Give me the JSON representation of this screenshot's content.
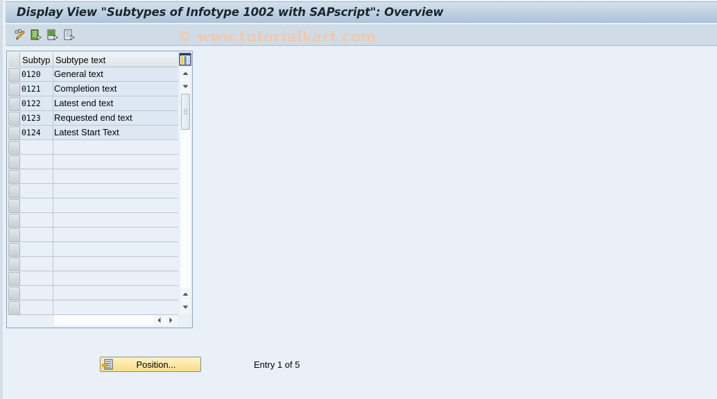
{
  "window": {
    "title": "Display View \"Subtypes of Infotype 1002 with SAPscript\": Overview"
  },
  "toolbar": {
    "buttons": [
      {
        "name": "display-change-button",
        "icon": "pencil-glasses-icon"
      },
      {
        "name": "select-all-button",
        "icon": "select-all-icon"
      },
      {
        "name": "select-block-button",
        "icon": "select-block-icon"
      },
      {
        "name": "deselect-all-button",
        "icon": "deselect-all-icon"
      }
    ],
    "watermark": "© www.tutorialkart.com"
  },
  "table": {
    "columns": [
      {
        "key": "subtype",
        "label": "Subtyp"
      },
      {
        "key": "text",
        "label": "Subtype text"
      }
    ],
    "rows": [
      {
        "subtype": "0120",
        "text": "General text"
      },
      {
        "subtype": "0121",
        "text": "Completion text"
      },
      {
        "subtype": "0122",
        "text": "Latest end text"
      },
      {
        "subtype": "0123",
        "text": "Requested end text"
      },
      {
        "subtype": "0124",
        "text": "Latest Start Text"
      }
    ],
    "empty_rows": 12,
    "settings_icon": "table-settings-icon"
  },
  "footer": {
    "position_button_label": "Position...",
    "entry_text": "Entry 1 of 5"
  }
}
